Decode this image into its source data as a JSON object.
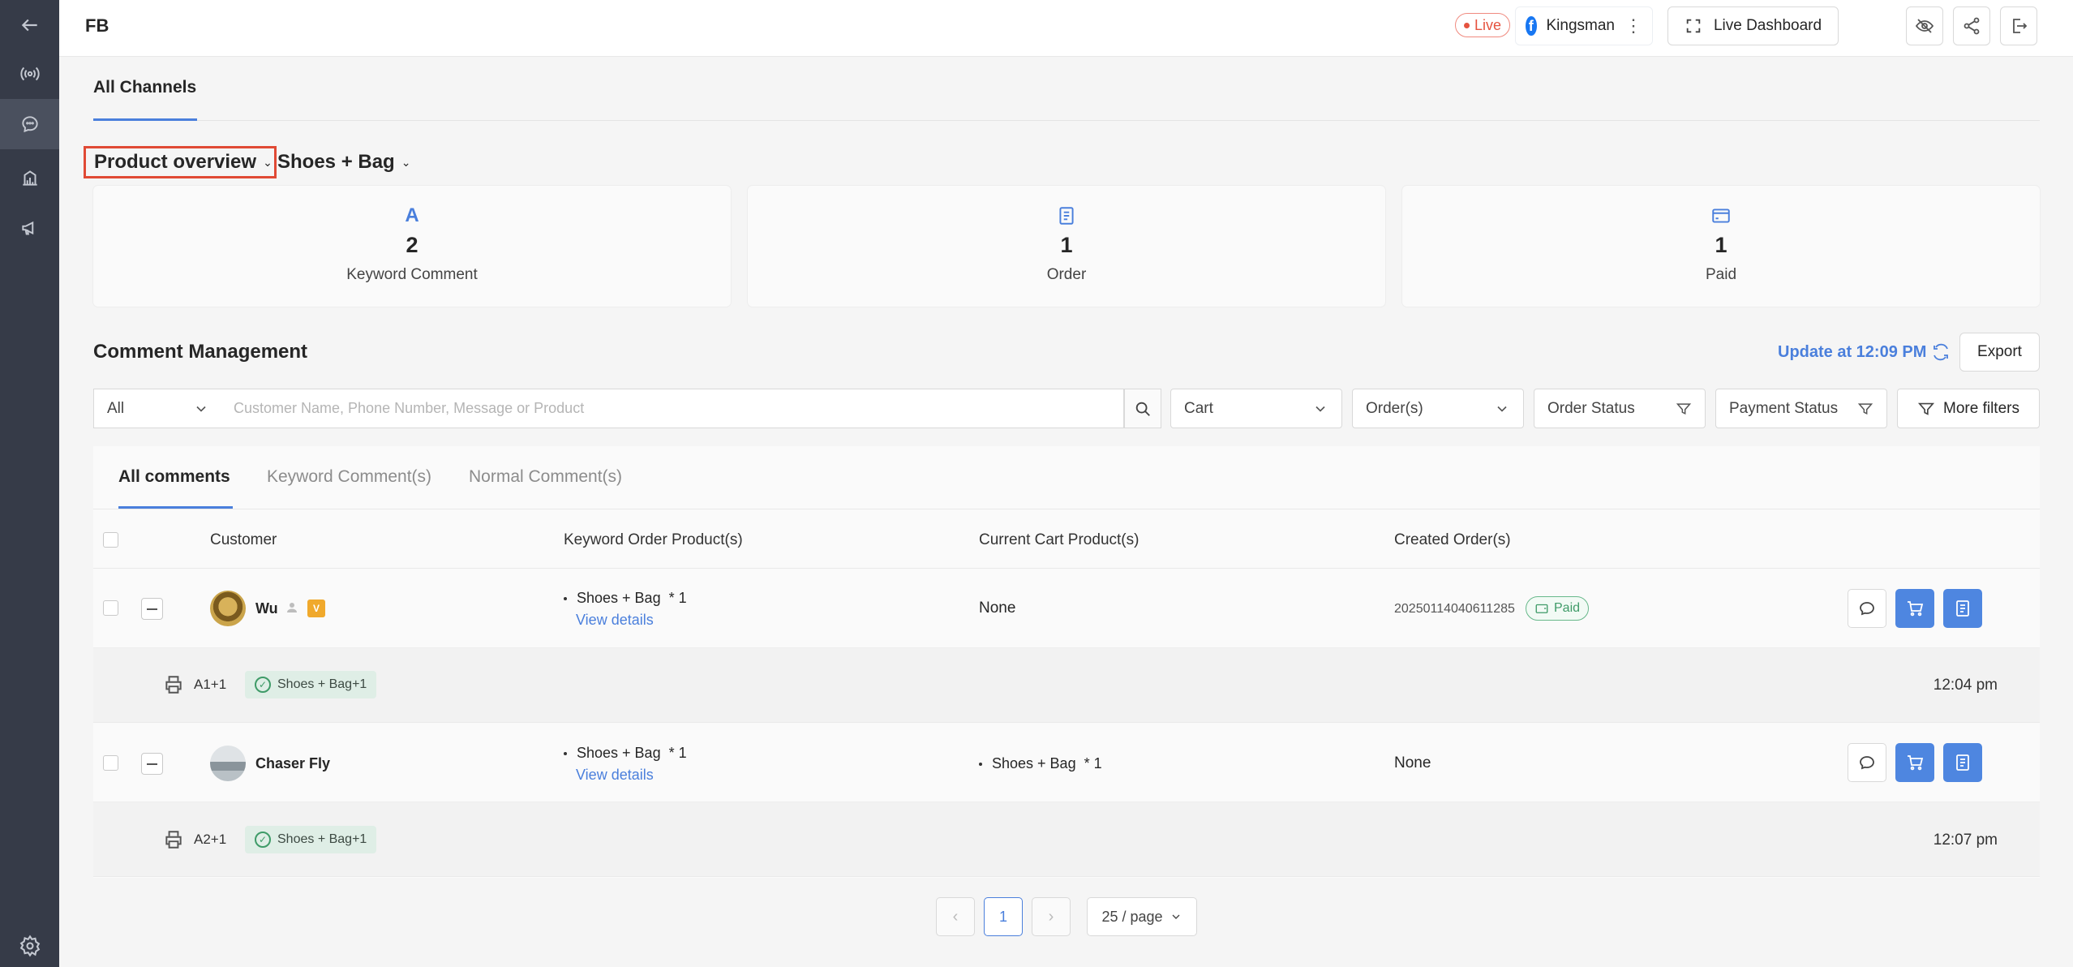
{
  "header": {
    "title": "FB",
    "live_badge": "Live",
    "page_name": "Kingsman",
    "live_dashboard_label": "Live Dashboard"
  },
  "channels": {
    "active_tab": "All Channels"
  },
  "overview": {
    "selector_label": "Product overview",
    "product_label": "Shoes + Bag",
    "stats": [
      {
        "icon": "A",
        "value": "2",
        "label": "Keyword Comment"
      },
      {
        "icon": "order-icon",
        "value": "1",
        "label": "Order"
      },
      {
        "icon": "card-icon",
        "value": "1",
        "label": "Paid"
      }
    ]
  },
  "comment_management": {
    "title": "Comment Management",
    "update_text": "Update at 12:09 PM",
    "export_label": "Export",
    "filters": {
      "scope": "All",
      "search_placeholder": "Customer Name, Phone Number, Message or Product",
      "cart": "Cart",
      "orders": "Order(s)",
      "order_status": "Order Status",
      "payment_status": "Payment Status",
      "more_filters": "More filters"
    },
    "tabs": [
      "All comments",
      "Keyword Comment(s)",
      "Normal Comment(s)"
    ],
    "columns": {
      "customer": "Customer",
      "keyword_products": "Keyword Order Product(s)",
      "cart_products": "Current Cart Product(s)",
      "created_orders": "Created Order(s)"
    },
    "rows": [
      {
        "customer": "Wu",
        "keyword_product": "Shoes + Bag",
        "keyword_qty": "* 1",
        "view_details": "View details",
        "cart_product": "None",
        "order_id": "20250114040611285",
        "order_status": "Paid",
        "comment_code": "A1+1",
        "comment_tag": "Shoes + Bag+1",
        "time": "12:04 pm"
      },
      {
        "customer": "Chaser Fly",
        "keyword_product": "Shoes + Bag",
        "keyword_qty": "* 1",
        "view_details": "View details",
        "cart_product": "Shoes + Bag",
        "cart_qty": "* 1",
        "order_none": "None",
        "comment_code": "A2+1",
        "comment_tag": "Shoes + Bag+1",
        "time": "12:07 pm"
      }
    ]
  },
  "pagination": {
    "current_page": "1",
    "page_size": "25 / page"
  },
  "colors": {
    "accent": "#4a7fdc",
    "sidebar": "#363b48",
    "live": "#e5533f",
    "paid": "#3f9b68"
  }
}
